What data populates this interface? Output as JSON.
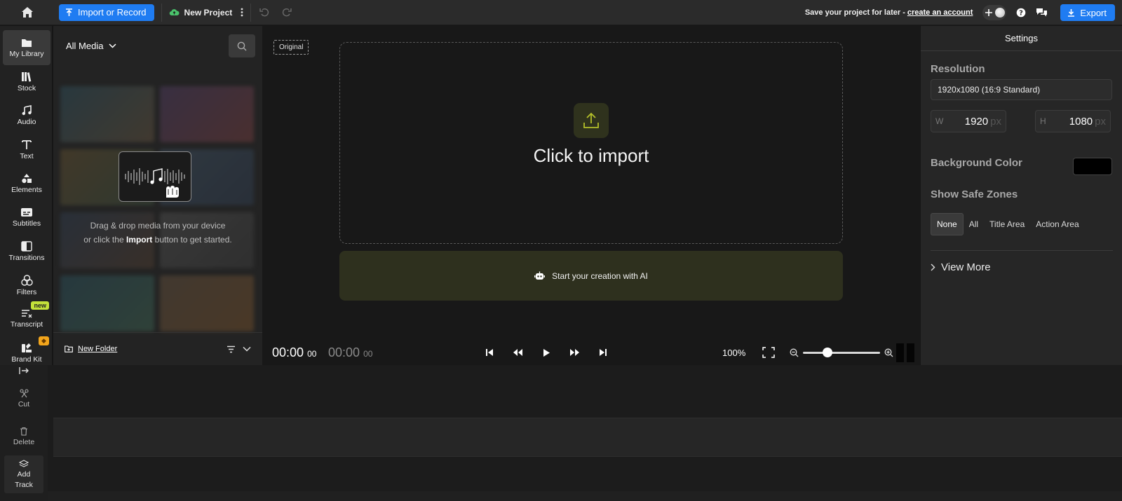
{
  "topbar": {
    "import_label": "Import or Record",
    "project_name": "New Project",
    "save_prompt": "Save your project for later -",
    "create_account": "create an account",
    "export_label": "Export"
  },
  "nav": {
    "items": [
      {
        "label": "My Library",
        "icon": "folder-icon"
      },
      {
        "label": "Stock",
        "icon": "books-icon"
      },
      {
        "label": "Audio",
        "icon": "music-note-icon"
      },
      {
        "label": "Text",
        "icon": "text-icon"
      },
      {
        "label": "Elements",
        "icon": "shapes-icon"
      },
      {
        "label": "Subtitles",
        "icon": "subtitles-icon"
      },
      {
        "label": "Transitions",
        "icon": "transition-icon"
      },
      {
        "label": "Filters",
        "icon": "filters-icon"
      },
      {
        "label": "Transcript",
        "icon": "transcript-icon"
      },
      {
        "label": "Brand Kit",
        "icon": "brand-kit-icon"
      }
    ],
    "new_badge": "new"
  },
  "media": {
    "filter_label": "All Media",
    "drop_line1": "Drag & drop media from your device",
    "drop_line2_pre": "or click the",
    "drop_line2_bold": "Import",
    "drop_line2_post": "button to get started.",
    "new_folder": "New Folder"
  },
  "preview": {
    "original_tag": "Original",
    "click_to_import": "Click to import",
    "ai_label": "Start your creation with AI",
    "time_current_main": "00:00",
    "time_current_frames": "00",
    "time_total_main": "00:00",
    "time_total_frames": "00",
    "zoom_percent": "100%",
    "zoom_slider_level": 0.32
  },
  "settings": {
    "title": "Settings",
    "resolution_label": "Resolution",
    "resolution_value": "1920x1080 (16:9 Standard)",
    "width_prefix": "W",
    "width_value": "1920",
    "height_prefix": "H",
    "height_value": "1080",
    "unit": "px",
    "background_label": "Background Color",
    "background_color": "#000000",
    "safe_zones_label": "Show Safe Zones",
    "safe_zones": [
      "None",
      "All",
      "Title Area",
      "Action Area"
    ],
    "safe_zone_selected": "None",
    "view_more": "View More"
  },
  "tools": {
    "cut": "Cut",
    "delete": "Delete",
    "add_track_1": "Add",
    "add_track_2": "Track"
  },
  "colors": {
    "accent": "#1f7cf2",
    "new_badge": "#c3e13a",
    "ai_bar": "#2e301e",
    "upload_icon": "#b3bf2a"
  }
}
